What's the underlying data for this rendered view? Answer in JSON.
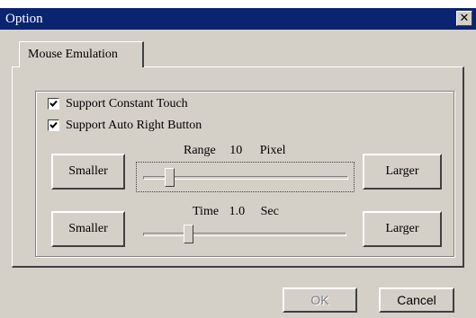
{
  "window": {
    "title": "Option",
    "close_glyph": "✕"
  },
  "tabs": [
    {
      "label": "Mouse Emulation",
      "selected": true
    }
  ],
  "options": {
    "constant_touch": {
      "label": "Support Constant Touch",
      "checked": true
    },
    "auto_right": {
      "label": "Support Auto Right Button",
      "checked": true
    }
  },
  "range": {
    "label": "Range",
    "value": "10",
    "unit": "Pixel",
    "smaller_label": "Smaller",
    "larger_label": "Larger",
    "level_fraction": 0.11
  },
  "time": {
    "label": "Time",
    "value": "1.0",
    "unit": "Sec",
    "smaller_label": "Smaller",
    "larger_label": "Larger",
    "level_fraction": 0.21
  },
  "buttons": {
    "ok": "OK",
    "cancel": "Cancel"
  },
  "colors": {
    "titlebar": "#0a2470",
    "face": "#d4d0c8"
  }
}
